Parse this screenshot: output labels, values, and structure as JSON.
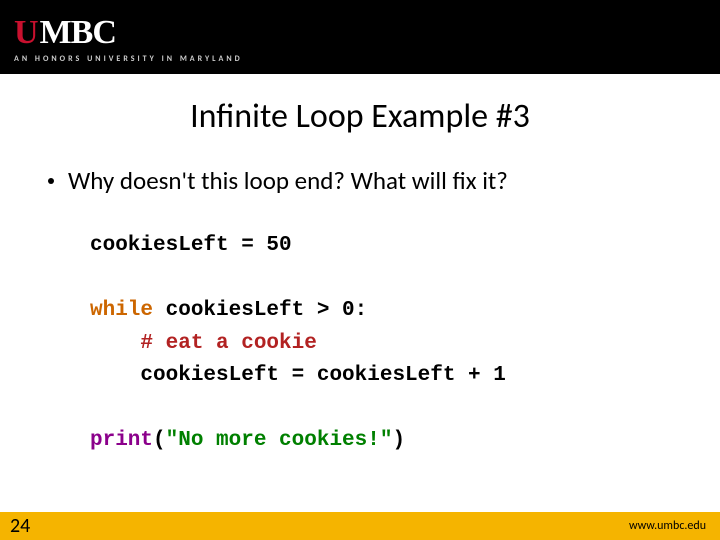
{
  "header": {
    "logo_prefix": "U",
    "logo_rest": "MBC",
    "tagline": "AN HONORS UNIVERSITY IN MARYLAND"
  },
  "title": "Infinite Loop Example #3",
  "bullet": "Why doesn't this loop end?  What will fix it?",
  "code": {
    "l1": "cookiesLeft = 50",
    "l2_kw": "while",
    "l2_rest": " cookiesLeft > 0:",
    "l3": "    # eat a cookie",
    "l4": "    cookiesLeft = cookiesLeft + 1",
    "l5_print": "print",
    "l5_open": "(",
    "l5_str": "\"No more cookies!\"",
    "l5_close": ")"
  },
  "footer": {
    "slide_number": "24",
    "url": "www.umbc.edu"
  }
}
